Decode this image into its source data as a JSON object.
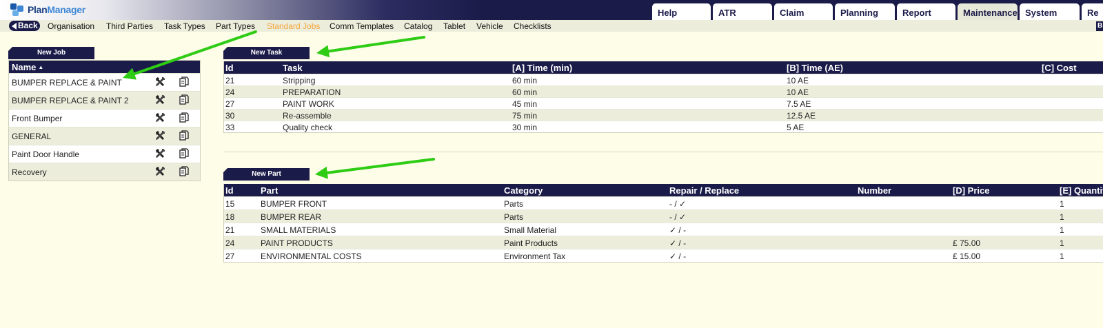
{
  "brand": {
    "plan": "Plan",
    "manager": "Manager"
  },
  "top_tabs": [
    "Help",
    "ATR",
    "Claim",
    "Planning",
    "Report",
    "Maintenance",
    "System",
    "Re"
  ],
  "active_top_tab": "Maintenance",
  "nav": {
    "back_label": "Back",
    "items": [
      "Organisation",
      "Third Parties",
      "Task Types",
      "Part Types",
      "Standard Jobs",
      "Comm Templates",
      "Catalog",
      "Tablet",
      "Vehicle",
      "Checklists"
    ],
    "active": "Standard Jobs",
    "corner_label": "B",
    "active_color": "#f3a43a",
    "bar_color": "#1b1b4a"
  },
  "buttons": {
    "new_job": "New Job",
    "new_task": "New Task",
    "new_part": "New Part"
  },
  "jobs": {
    "header": "Name",
    "sort_indicator": "▲",
    "rows": [
      "BUMPER REPLACE & PAINT",
      "BUMPER REPLACE & PAINT 2",
      "Front Bumper",
      "GENERAL",
      "Paint Door Handle",
      "Recovery"
    ],
    "tool_icon": "tools-icon",
    "copy_icon": "copy-icon"
  },
  "tasks": {
    "columns": [
      "Id",
      "Task",
      "[A] Time (min)",
      "[B] Time (AE)",
      "[C] Cost"
    ],
    "rows": [
      [
        "21",
        "Stripping",
        "60 min",
        "10 AE",
        ""
      ],
      [
        "24",
        "PREPARATION",
        "60 min",
        "10 AE",
        ""
      ],
      [
        "27",
        "PAINT WORK",
        "45 min",
        "7.5 AE",
        ""
      ],
      [
        "30",
        "Re-assemble",
        "75 min",
        "12.5 AE",
        ""
      ],
      [
        "33",
        "Quality check",
        "30 min",
        "5 AE",
        ""
      ]
    ]
  },
  "parts": {
    "columns": [
      "Id",
      "Part",
      "Category",
      "Repair / Replace",
      "Number",
      "[D] Price",
      "[E] Quantity"
    ],
    "rows": [
      {
        "id": "15",
        "part": "BUMPER FRONT",
        "category": "Parts",
        "repair": "-",
        "replace": "✓",
        "number": "",
        "price": "",
        "qty": "1"
      },
      {
        "id": "18",
        "part": "BUMPER REAR",
        "category": "Parts",
        "repair": "-",
        "replace": "✓",
        "number": "",
        "price": "",
        "qty": "1"
      },
      {
        "id": "21",
        "part": "SMALL MATERIALS",
        "category": "Small Material",
        "repair": "✓",
        "replace": "-",
        "number": "",
        "price": "",
        "qty": "1"
      },
      {
        "id": "24",
        "part": "PAINT PRODUCTS",
        "category": "Paint Products",
        "repair": "✓",
        "replace": "-",
        "number": "",
        "price": "£ 75.00",
        "qty": "1"
      },
      {
        "id": "27",
        "part": "ENVIRONMENTAL COSTS",
        "category": "Environment Tax",
        "repair": "✓",
        "replace": "-",
        "number": "",
        "price": "£ 15.00",
        "qty": "1"
      }
    ],
    "separator": "/",
    "check_color": "#2fa020"
  },
  "annotation_color": "#2ecc14"
}
